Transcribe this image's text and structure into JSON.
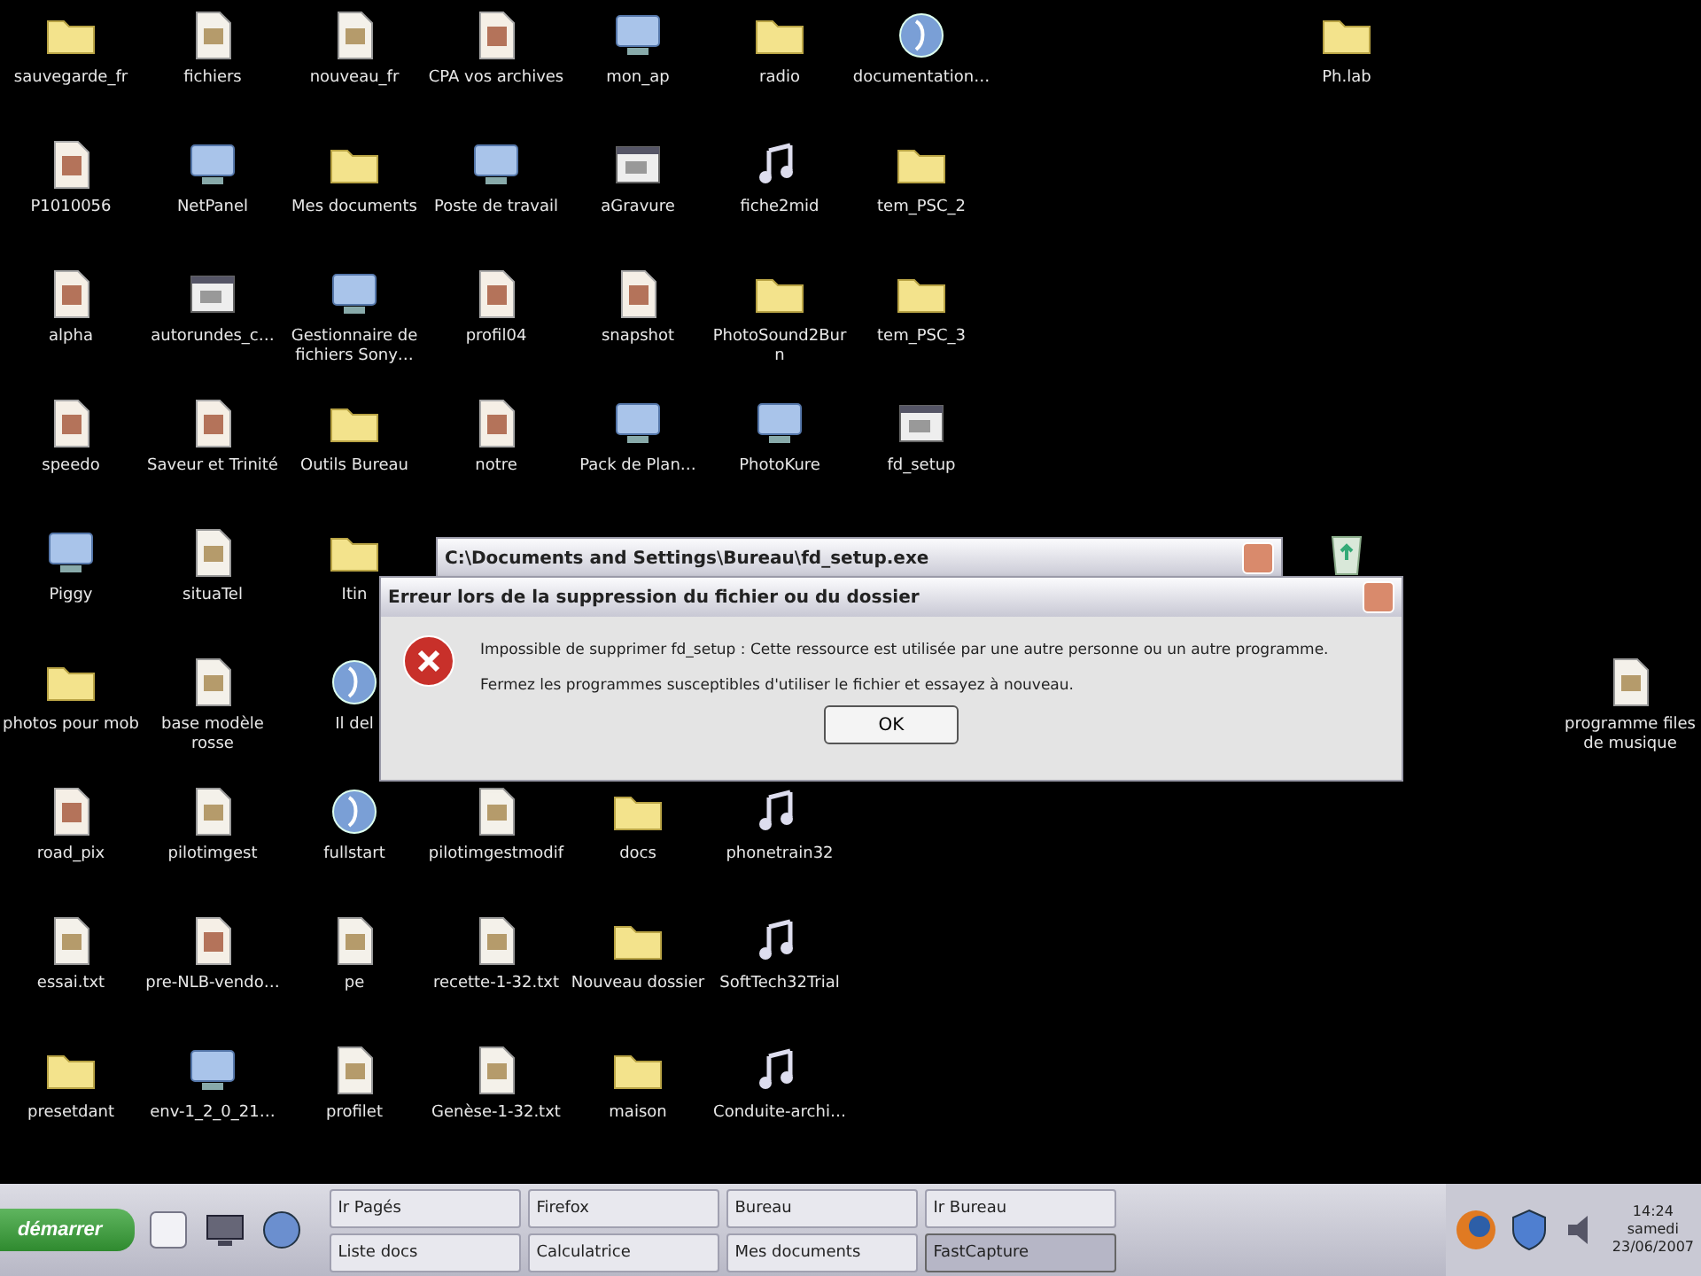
{
  "desktop": {
    "rows": [
      [
        {
          "label": "sauvegarde_fr",
          "kind": "folder"
        },
        {
          "label": "fichiers",
          "kind": "doc"
        },
        {
          "label": "nouveau_fr",
          "kind": "doc"
        },
        {
          "label": "CPA vos archives",
          "kind": "image"
        },
        {
          "label": "mon_ap",
          "kind": "app"
        },
        {
          "label": "radio",
          "kind": "folder"
        },
        {
          "label": "documentation…",
          "kind": "globe"
        }
      ],
      [
        {
          "label": "P1010056",
          "kind": "image"
        },
        {
          "label": "NetPanel",
          "kind": "app"
        },
        {
          "label": "Mes documents",
          "kind": "folder"
        },
        {
          "label": "Poste de travail",
          "kind": "app"
        },
        {
          "label": "aGravure",
          "kind": "setup"
        },
        {
          "label": "fiche2mid",
          "kind": "music"
        },
        {
          "label": "tem_PSC_2",
          "kind": "folder"
        }
      ],
      [
        {
          "label": "alpha",
          "kind": "image"
        },
        {
          "label": "autorundes_c…",
          "kind": "setup"
        },
        {
          "label": "Gestionnaire de fichiers Sony…",
          "kind": "app"
        },
        {
          "label": "profil04",
          "kind": "image"
        },
        {
          "label": "snapshot",
          "kind": "image"
        },
        {
          "label": "PhotoSound2Burn",
          "kind": "folder"
        },
        {
          "label": "tem_PSC_3",
          "kind": "folder"
        }
      ],
      [
        {
          "label": "speedo",
          "kind": "image"
        },
        {
          "label": "Saveur et Trinité",
          "kind": "image"
        },
        {
          "label": "Outils Bureau",
          "kind": "folder"
        },
        {
          "label": "notre",
          "kind": "image"
        },
        {
          "label": "Pack de Plan…",
          "kind": "app"
        },
        {
          "label": "PhotoKure",
          "kind": "app"
        },
        {
          "label": "fd_setup",
          "kind": "setup"
        }
      ],
      [
        {
          "label": "Piggy",
          "kind": "app"
        },
        {
          "label": "situaTel",
          "kind": "doc"
        },
        {
          "label": "Itin",
          "kind": "folder"
        }
      ],
      [
        {
          "label": "photos pour mob",
          "kind": "folder"
        },
        {
          "label": "base modèle rosse",
          "kind": "doc"
        },
        {
          "label": "Il del",
          "kind": "globe"
        }
      ],
      [
        {
          "label": "road_pix",
          "kind": "image"
        },
        {
          "label": "pilotimgest",
          "kind": "doc"
        },
        {
          "label": "fullstart",
          "kind": "globe"
        },
        {
          "label": "pilotimgestmodif",
          "kind": "doc"
        },
        {
          "label": "docs",
          "kind": "folder"
        },
        {
          "label": "phonetrain32",
          "kind": "music"
        }
      ],
      [
        {
          "label": "essai.txt",
          "kind": "doc"
        },
        {
          "label": "pre-NLB-vendo…",
          "kind": "image"
        },
        {
          "label": "pe",
          "kind": "doc"
        },
        {
          "label": "recette-1-32.txt",
          "kind": "doc"
        },
        {
          "label": "Nouveau dossier",
          "kind": "folder"
        },
        {
          "label": "SoftTech32Trial",
          "kind": "music"
        }
      ],
      [
        {
          "label": "presetdant",
          "kind": "folder"
        },
        {
          "label": "env-1_2_0_21…",
          "kind": "app"
        },
        {
          "label": "profilet",
          "kind": "doc"
        },
        {
          "label": "Genèse-1-32.txt",
          "kind": "doc"
        },
        {
          "label": "maison",
          "kind": "folder"
        },
        {
          "label": "Conduite-archi…",
          "kind": "music"
        }
      ]
    ],
    "extra_icons": [
      {
        "label": "Ph.lab",
        "kind": "folder"
      },
      {
        "kind": "recycle"
      },
      {
        "label": "programme files de musique",
        "kind": "doc"
      }
    ]
  },
  "back_window": {
    "title": "C:\\Documents and Settings\\Bureau\\fd_setup.exe"
  },
  "dialog": {
    "title": "Erreur lors de la suppression du fichier ou du dossier",
    "message": "Impossible de supprimer fd_setup : Cette ressource est utilisée par une autre personne ou un autre programme.",
    "hint": "Fermez les programmes susceptibles d'utiliser le fichier et essayez à nouveau.",
    "button": "OK"
  },
  "taskbar": {
    "start": "démarrer",
    "tasks": [
      {
        "label": "Ir Pagés",
        "selected": false
      },
      {
        "label": "Firefox",
        "selected": false
      },
      {
        "label": "Bureau",
        "selected": false
      },
      {
        "label": "Ir Bureau",
        "selected": false
      },
      {
        "label": "Liste docs",
        "selected": false
      },
      {
        "label": "Calculatrice",
        "selected": false
      },
      {
        "label": "Mes documents",
        "selected": false
      },
      {
        "label": "FastCapture",
        "selected": true
      }
    ],
    "clock": {
      "time": "14:24",
      "day": "samedi",
      "date": "23/06/2007"
    }
  }
}
